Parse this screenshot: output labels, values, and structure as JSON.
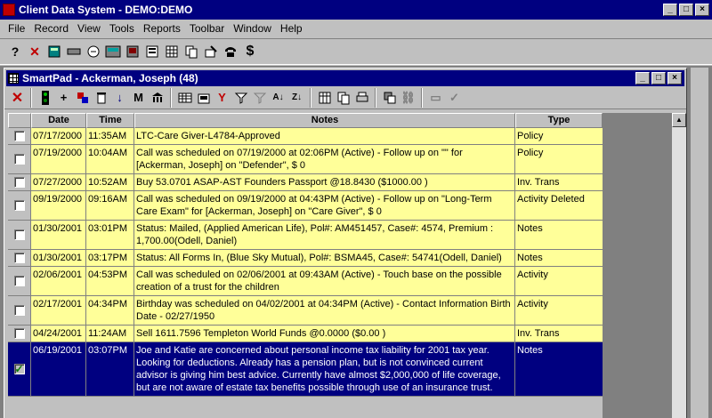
{
  "app": {
    "title": "Client Data System - DEMO:DEMO"
  },
  "menu": [
    {
      "label": "File"
    },
    {
      "label": "Record"
    },
    {
      "label": "View"
    },
    {
      "label": "Tools"
    },
    {
      "label": "Reports"
    },
    {
      "label": "Toolbar"
    },
    {
      "label": "Window"
    },
    {
      "label": "Help"
    }
  ],
  "window_buttons": {
    "minimize": "_",
    "maximize": "□",
    "close": "×"
  },
  "child": {
    "title": "SmartPad - Ackerman, Joseph (48)"
  },
  "grid": {
    "headers": {
      "date": "Date",
      "time": "Time",
      "notes": "Notes",
      "type": "Type"
    },
    "rows": [
      {
        "date": "07/17/2000",
        "time": "11:35AM",
        "notes": "LTC-Care Giver-L4784-Approved",
        "type": "Policy"
      },
      {
        "date": "07/19/2000",
        "time": "10:04AM",
        "notes": "Call was scheduled on 07/19/2000 at 02:06PM (Active) - Follow up on \"\" for [Ackerman, Joseph] on \"Defender\", $ 0",
        "type": "Policy"
      },
      {
        "date": "07/27/2000",
        "time": "10:52AM",
        "notes": "Buy  53.0701        ASAP-AST Founders Passport  @18.8430      ($1000.00     )",
        "type": "Inv. Trans"
      },
      {
        "date": "09/19/2000",
        "time": "09:16AM",
        "notes": "Call was scheduled on 09/19/2000 at 04:43PM (Active) - Follow up on \"Long-Term Care Exam\" for [Ackerman, Joseph] on \"Care Giver\", $ 0",
        "type": "Activity Deleted"
      },
      {
        "date": "01/30/2001",
        "time": "03:01PM",
        "notes": "Status: Mailed,  (Applied American Life),   Pol#: AM451457,    Case#: 4574,    Premium : 1,700.00(Odell, Daniel)",
        "type": "Notes"
      },
      {
        "date": "01/30/2001",
        "time": "03:17PM",
        "notes": "Status: All Forms In,  (Blue Sky Mutual),   Pol#: BSMA45,   Case#: 54741(Odell, Daniel)",
        "type": "Notes"
      },
      {
        "date": "02/06/2001",
        "time": "04:53PM",
        "notes": "Call was scheduled on 02/06/2001 at 09:43AM (Active) - Touch base on the possible creation of a trust for the children",
        "type": "Activity"
      },
      {
        "date": "02/17/2001",
        "time": "04:34PM",
        "notes": "Birthday was scheduled on 04/02/2001 at 04:34PM (Active) - Contact Information Birth Date - 02/27/1950",
        "type": "Activity"
      },
      {
        "date": "04/24/2001",
        "time": "11:24AM",
        "notes": "Sell  1611.7596      Templeton World Funds  @0.0000      ($0.00       )",
        "type": "Inv. Trans"
      },
      {
        "date": "06/19/2001",
        "time": "03:07PM",
        "notes": "Joe and Katie are concerned about personal income tax liability for 2001 tax year.  Looking for deductions.  Already has a pension plan, but is not convinced current advisor is giving him best advice.  Currently have almost $2,000,000 of life coverage, but are not aware of estate tax benefits possible through use of an insurance trust.",
        "type": "Notes",
        "selected": true
      }
    ]
  }
}
